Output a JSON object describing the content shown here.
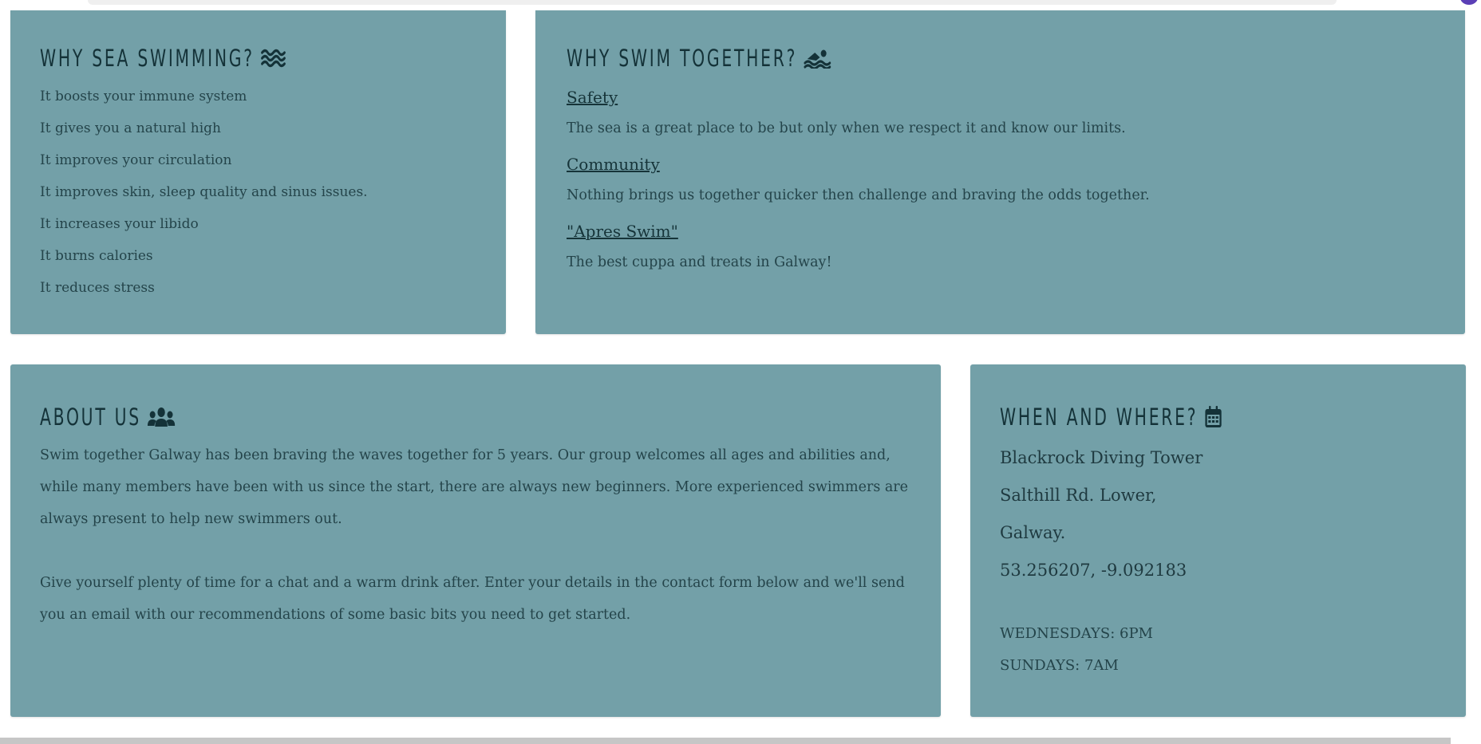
{
  "colors": {
    "card_bg": "#73a0a8",
    "heading": "#143238",
    "text": "#24444a",
    "page_bg": "#ffffff"
  },
  "why_sea": {
    "title": "WHY SEA SWIMMING?",
    "icon": "water-waves-icon",
    "items": [
      "It boosts your immune system",
      "It gives you a natural high",
      "It improves your circulation",
      "It improves skin, sleep quality and sinus issues.",
      "It increases your libido",
      "It burns calories",
      "It reduces stress"
    ]
  },
  "why_swim": {
    "title": "WHY SWIM TOGETHER?",
    "icon": "swimmer-icon",
    "sections": [
      {
        "heading": "Safety",
        "text": "The sea is a great place to be but only when we respect it and know our limits."
      },
      {
        "heading": "Community",
        "text": "Nothing brings us together quicker then challenge and braving the odds together."
      },
      {
        "heading": "\"Apres Swim\"",
        "text": "The best cuppa and treats in Galway!"
      }
    ]
  },
  "about": {
    "title": "ABOUT US",
    "icon": "users-group-icon",
    "paragraphs": [
      "Swim together Galway has been braving the waves together for 5 years. Our group welcomes all ages and abilities and, while many members have been with us since the start, there are always new beginners. More experienced swimmers are always present to help new swimmers out.",
      "Give yourself plenty of time for a chat and a warm drink after. Enter your details in the contact form below and we'll send you an email with our recommendations of some basic bits you need to get started."
    ]
  },
  "when_where": {
    "title": "WHEN AND WHERE?",
    "icon": "calendar-icon",
    "address": [
      "Blackrock Diving Tower",
      "Salthill Rd. Lower,",
      "Galway."
    ],
    "coordinates": "53.256207, -9.092183",
    "times": [
      "WEDNESDAYS: 6PM",
      "SUNDAYS: 7AM"
    ]
  }
}
